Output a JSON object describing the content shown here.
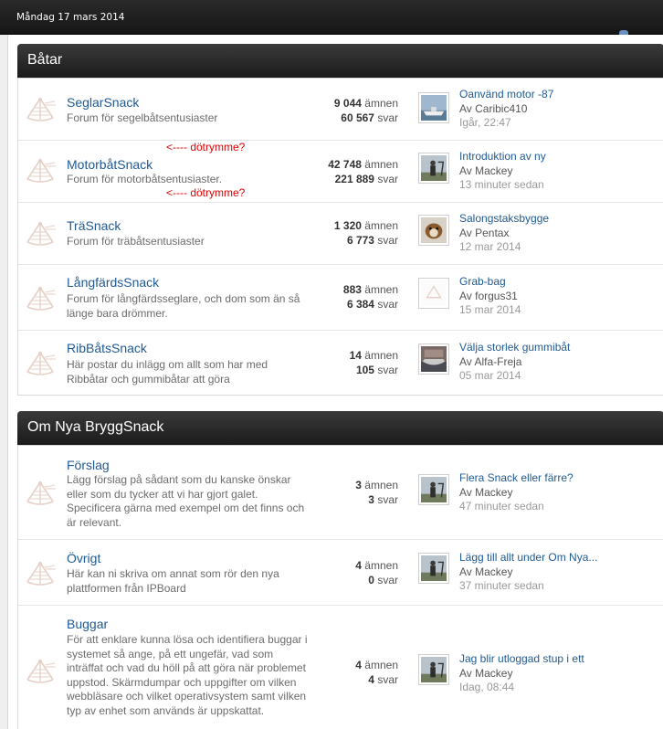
{
  "header": {
    "date": "Måndag 17 mars 2014"
  },
  "categories": [
    {
      "title": "Båtar",
      "forums": [
        {
          "name": "SeglarSnack",
          "desc": "Forum för segelbåtsentusiaster",
          "topics": "9 044",
          "topics_label": "ämnen",
          "posts": "60 567",
          "posts_label": "svar",
          "last": {
            "title": "Oanvänd motor -87",
            "by": "Av Caribic410",
            "time": "Igår, 22:47"
          }
        },
        {
          "name": "MotorbåtSnack",
          "desc": "Forum för motorbåtsentusiaster.",
          "topics": "42 748",
          "topics_label": "ämnen",
          "posts": "221 889",
          "posts_label": "svar",
          "last": {
            "title": "Introduktion av ny",
            "by": "Av Mackey",
            "time": "13 minuter sedan"
          }
        },
        {
          "name": "TräSnack",
          "desc": "Forum för träbåtsentusiaster",
          "topics": "1 320",
          "topics_label": "ämnen",
          "posts": "6 773",
          "posts_label": "svar",
          "last": {
            "title": "Salongstaksbygge",
            "by": "Av Pentax",
            "time": "12 mar 2014"
          }
        },
        {
          "name": "LångfärdsSnack",
          "desc": "Forum för långfärdsseglare, och dom som än så länge bara drömmer.",
          "topics": "883",
          "topics_label": "ämnen",
          "posts": "6 384",
          "posts_label": "svar",
          "last": {
            "title": "Grab-bag",
            "by": "Av forgus31",
            "time": "15 mar 2014"
          }
        },
        {
          "name": "RibBåtsSnack",
          "desc": "Här postar du inlägg om allt som har med Ribbåtar och gummibåtar att göra",
          "topics": "14",
          "topics_label": "ämnen",
          "posts": "105",
          "posts_label": "svar",
          "last": {
            "title": "Välja storlek gummibåt",
            "by": "Av Alfa-Freja",
            "time": "05 mar 2014"
          }
        }
      ]
    },
    {
      "title": "Om Nya BryggSnack",
      "forums": [
        {
          "name": "Förslag",
          "desc": "Lägg förslag på sådant som du kanske önskar eller som du tycker att vi har gjort galet. Specificera gärna med exempel om det finns och är relevant.",
          "topics": "3",
          "topics_label": "ämnen",
          "posts": "3",
          "posts_label": "svar",
          "last": {
            "title": "Flera Snack eller färre?",
            "by": "Av Mackey",
            "time": "47 minuter sedan"
          }
        },
        {
          "name": "Övrigt",
          "desc": "Här kan ni skriva om annat som rör den nya plattformen från IPBoard",
          "topics": "4",
          "topics_label": "ämnen",
          "posts": "0",
          "posts_label": "svar",
          "last": {
            "title": "Lägg till allt under Om Nya...",
            "by": "Av Mackey",
            "time": "37 minuter sedan"
          }
        },
        {
          "name": "Buggar",
          "desc": "För att enklare kunna lösa och identifiera buggar i systemet så ange, på ett ungefär, vad som inträffat och vad du höll på att göra när problemet uppstod. Skärmdumpar och uppgifter om vilken webbläsare och vilket operativsystem samt vilken typ av enhet som används är uppskattat.",
          "topics": "4",
          "topics_label": "ämnen",
          "posts": "4",
          "posts_label": "svar",
          "last": {
            "title": "Jag blir utloggad stup i ett",
            "by": "Av Mackey",
            "time": "Idag, 08:44"
          }
        }
      ]
    }
  ],
  "annotations": {
    "text": "<---- dötrymme?",
    "color": "#e00000"
  },
  "colors": {
    "link": "#1f5a94",
    "header_bg": "#1b1b1b"
  }
}
